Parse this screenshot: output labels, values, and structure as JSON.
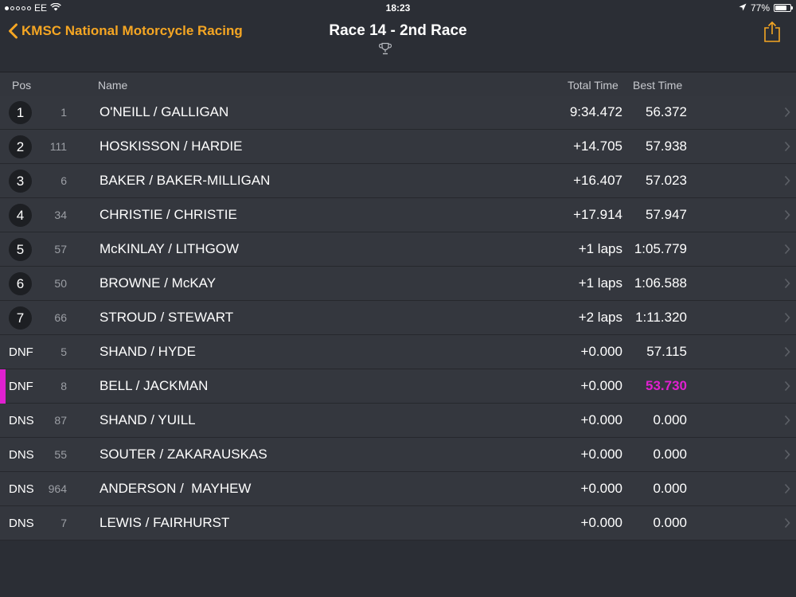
{
  "status_bar": {
    "carrier": "EE",
    "time": "18:23",
    "battery": "77%",
    "battery_level": 0.77
  },
  "nav": {
    "back_label": "KMSC National Motorcycle Racing",
    "title": "Race 14 - 2nd Race",
    "accent_color": "#f5a623"
  },
  "columns": {
    "pos": "Pos",
    "name": "Name",
    "total_time": "Total Time",
    "best_time": "Best Time"
  },
  "highlight_color": "#e020d0",
  "rows": [
    {
      "pos": "1",
      "num": "1",
      "name": "O'NEILL / GALLIGAN",
      "total": "9:34.472",
      "best": "56.372",
      "circle": true,
      "highlight": false
    },
    {
      "pos": "2",
      "num": "111",
      "name": "HOSKISSON / HARDIE",
      "total": "+14.705",
      "best": "57.938",
      "circle": true,
      "highlight": false
    },
    {
      "pos": "3",
      "num": "6",
      "name": "BAKER / BAKER-MILLIGAN",
      "total": "+16.407",
      "best": "57.023",
      "circle": true,
      "highlight": false
    },
    {
      "pos": "4",
      "num": "34",
      "name": "CHRISTIE / CHRISTIE",
      "total": "+17.914",
      "best": "57.947",
      "circle": true,
      "highlight": false
    },
    {
      "pos": "5",
      "num": "57",
      "name": "McKINLAY / LITHGOW",
      "total": "+1 laps",
      "best": "1:05.779",
      "circle": true,
      "highlight": false
    },
    {
      "pos": "6",
      "num": "50",
      "name": "BROWNE / McKAY",
      "total": "+1 laps",
      "best": "1:06.588",
      "circle": true,
      "highlight": false
    },
    {
      "pos": "7",
      "num": "66",
      "name": "STROUD / STEWART",
      "total": "+2 laps",
      "best": "1:11.320",
      "circle": true,
      "highlight": false
    },
    {
      "pos": "DNF",
      "num": "5",
      "name": "SHAND / HYDE",
      "total": "+0.000",
      "best": "57.115",
      "circle": false,
      "highlight": false
    },
    {
      "pos": "DNF",
      "num": "8",
      "name": "BELL / JACKMAN",
      "total": "+0.000",
      "best": "53.730",
      "circle": false,
      "highlight": true
    },
    {
      "pos": "DNS",
      "num": "87",
      "name": "SHAND / YUILL",
      "total": "+0.000",
      "best": "0.000",
      "circle": false,
      "highlight": false
    },
    {
      "pos": "DNS",
      "num": "55",
      "name": "SOUTER / ZAKARAUSKAS",
      "total": "+0.000",
      "best": "0.000",
      "circle": false,
      "highlight": false
    },
    {
      "pos": "DNS",
      "num": "964",
      "name": "ANDERSON /  MAYHEW",
      "total": "+0.000",
      "best": "0.000",
      "circle": false,
      "highlight": false
    },
    {
      "pos": "DNS",
      "num": "7",
      "name": "LEWIS / FAIRHURST",
      "total": "+0.000",
      "best": "0.000",
      "circle": false,
      "highlight": false
    }
  ]
}
